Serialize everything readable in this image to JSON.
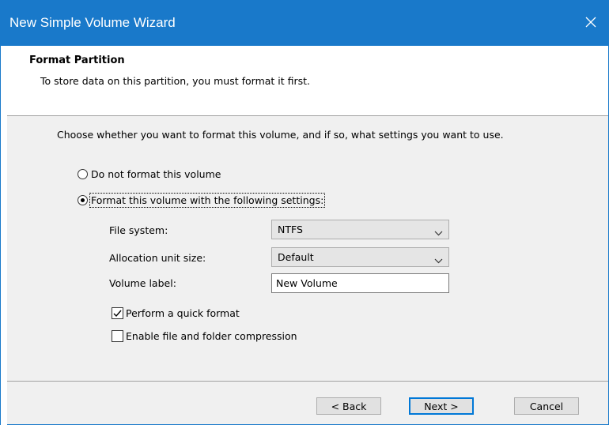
{
  "window": {
    "title": "New Simple Volume Wizard",
    "close_glyph": "×"
  },
  "header": {
    "title": "Format Partition",
    "subtitle": "To store data on this partition, you must format it first."
  },
  "intro": "Choose whether you want to format this volume, and if so, what settings you want to use.",
  "options": {
    "no_format": {
      "label": "Do not format this volume",
      "selected": false
    },
    "format": {
      "label": "Format this volume with the following settings:",
      "selected": true
    }
  },
  "settings": {
    "file_system": {
      "label": "File system:",
      "value": "NTFS"
    },
    "allocation_unit": {
      "label": "Allocation unit size:",
      "value": "Default"
    },
    "volume_label": {
      "label": "Volume label:",
      "value": "New Volume"
    }
  },
  "checks": {
    "quick_format": {
      "label": "Perform a quick format",
      "checked": true
    },
    "compression": {
      "label": "Enable file and folder compression",
      "checked": false
    }
  },
  "buttons": {
    "back": "< Back",
    "next": "Next >",
    "cancel": "Cancel"
  },
  "colors": {
    "titlebar": "#1979ca",
    "accent": "#0078d7"
  },
  "icons": {
    "close": "close-icon",
    "dropdown": "chevron-down-icon",
    "check": "checkmark-icon"
  }
}
